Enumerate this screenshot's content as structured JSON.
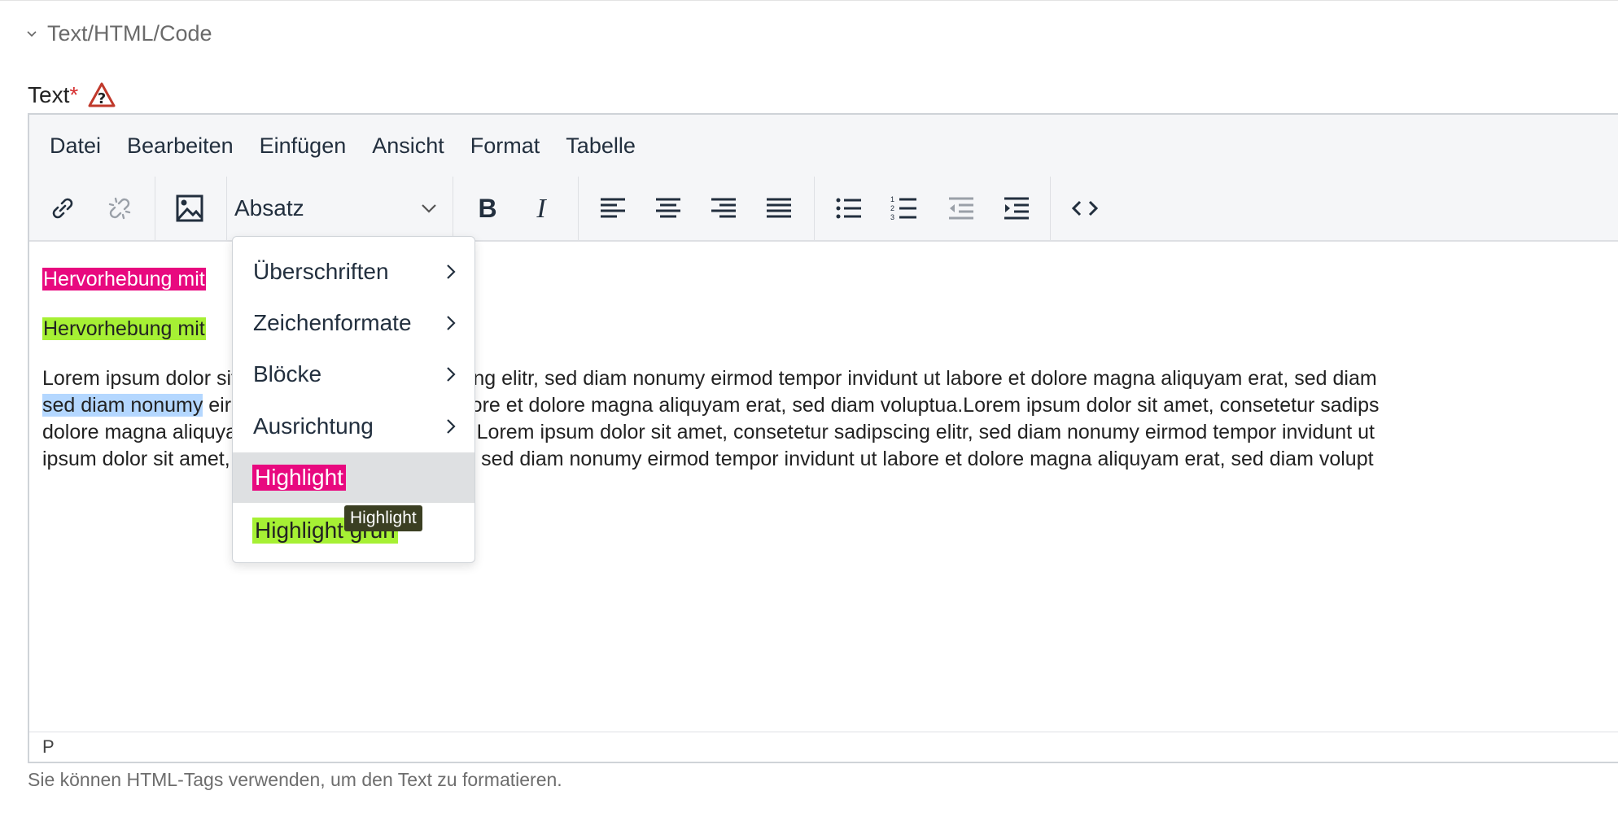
{
  "section": {
    "title": "Text/HTML/Code"
  },
  "field": {
    "label": "Text",
    "required_mark": "*"
  },
  "menubar": {
    "items": [
      "Datei",
      "Bearbeiten",
      "Einfügen",
      "Ansicht",
      "Format",
      "Tabelle"
    ]
  },
  "toolbar": {
    "block_format": "Absatz"
  },
  "content": {
    "p1": "Hervorhebung mit",
    "p2": "Hervorhebung mit",
    "p3_lines": [
      "Lorem ipsum dolor sit amet, consetetur sadipscing elitr, sed diam nonumy eirmod tempor invidunt ut labore et dolore magna aliquyam erat, sed diam",
      "sed diam nonumy eirmod tempor invidunt ut labore et dolore magna aliquyam erat, sed diam voluptua.Lorem ipsum dolor sit amet, consetetur sadips",
      "dolore magna aliquyam erat, sed diam voluptua.Lorem ipsum dolor sit amet, consetetur sadipscing elitr, sed diam nonumy eirmod tempor invidunt ut",
      "ipsum dolor sit amet, consetetur sadipscing elitr, sed diam nonumy eirmod tempor invidunt ut labore et dolore magna aliquyam erat, sed diam volupt"
    ],
    "p3_selected": "sed diam nonumy"
  },
  "dropdown": {
    "items": [
      {
        "label": "Überschriften",
        "has_submenu": true
      },
      {
        "label": "Zeichenformate",
        "has_submenu": true
      },
      {
        "label": "Blöcke",
        "has_submenu": true
      },
      {
        "label": "Ausrichtung",
        "has_submenu": true
      },
      {
        "label": "Highlight",
        "has_submenu": false,
        "style": "pink",
        "active": true
      },
      {
        "label": "Highlight grün",
        "has_submenu": false,
        "style": "green"
      }
    ]
  },
  "tooltip": {
    "text": "Highlight"
  },
  "statusbar": {
    "path": "P"
  },
  "help_text": "Sie können HTML-Tags verwenden, um den Text zu formatieren.",
  "colors": {
    "highlight_pink": "#e8097f",
    "highlight_green": "#a6f034",
    "selection": "#b4d7ff",
    "required": "#d63031"
  }
}
